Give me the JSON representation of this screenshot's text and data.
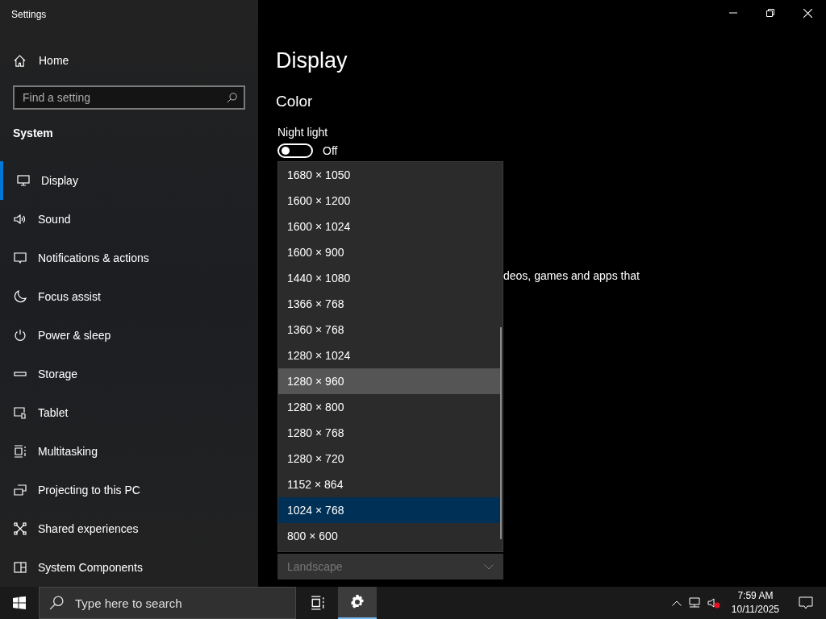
{
  "window": {
    "title": "Settings"
  },
  "sidebar": {
    "home": "Home",
    "search": {
      "placeholder": "Find a setting"
    },
    "section": "System",
    "items": [
      {
        "label": "Display",
        "selected": true
      },
      {
        "label": "Sound",
        "selected": false
      },
      {
        "label": "Notifications & actions",
        "selected": false
      },
      {
        "label": "Focus assist",
        "selected": false
      },
      {
        "label": "Power & sleep",
        "selected": false
      },
      {
        "label": "Storage",
        "selected": false
      },
      {
        "label": "Tablet",
        "selected": false
      },
      {
        "label": "Multitasking",
        "selected": false
      },
      {
        "label": "Projecting to this PC",
        "selected": false
      },
      {
        "label": "Shared experiences",
        "selected": false
      },
      {
        "label": "System Components",
        "selected": false
      }
    ]
  },
  "main": {
    "title": "Display",
    "section": "Color",
    "night_light": {
      "label": "Night light",
      "on": false,
      "state": "Off"
    },
    "description_fragment": "deos, games and apps that",
    "orientation": {
      "value": "Landscape",
      "disabled": true
    }
  },
  "resolution_dropdown": {
    "options": [
      {
        "label": "1680 × 1050",
        "selected": false,
        "hovered": false
      },
      {
        "label": "1600 × 1200",
        "selected": false,
        "hovered": false
      },
      {
        "label": "1600 × 1024",
        "selected": false,
        "hovered": false
      },
      {
        "label": "1600 × 900",
        "selected": false,
        "hovered": false
      },
      {
        "label": "1440 × 1080",
        "selected": false,
        "hovered": false
      },
      {
        "label": "1366 × 768",
        "selected": false,
        "hovered": false
      },
      {
        "label": "1360 × 768",
        "selected": false,
        "hovered": false
      },
      {
        "label": "1280 × 1024",
        "selected": false,
        "hovered": false
      },
      {
        "label": "1280 × 960",
        "selected": false,
        "hovered": true
      },
      {
        "label": "1280 × 800",
        "selected": false,
        "hovered": false
      },
      {
        "label": "1280 × 768",
        "selected": false,
        "hovered": false
      },
      {
        "label": "1280 × 720",
        "selected": false,
        "hovered": false
      },
      {
        "label": "1152 × 864",
        "selected": false,
        "hovered": false
      },
      {
        "label": "1024 × 768",
        "selected": true,
        "hovered": false
      },
      {
        "label": "800 × 600",
        "selected": false,
        "hovered": false
      }
    ]
  },
  "taskbar": {
    "search": {
      "placeholder": "Type here to search"
    },
    "settings_active": true,
    "time": "7:59 AM",
    "date": "10/11/2025",
    "sound_muted": true
  }
}
